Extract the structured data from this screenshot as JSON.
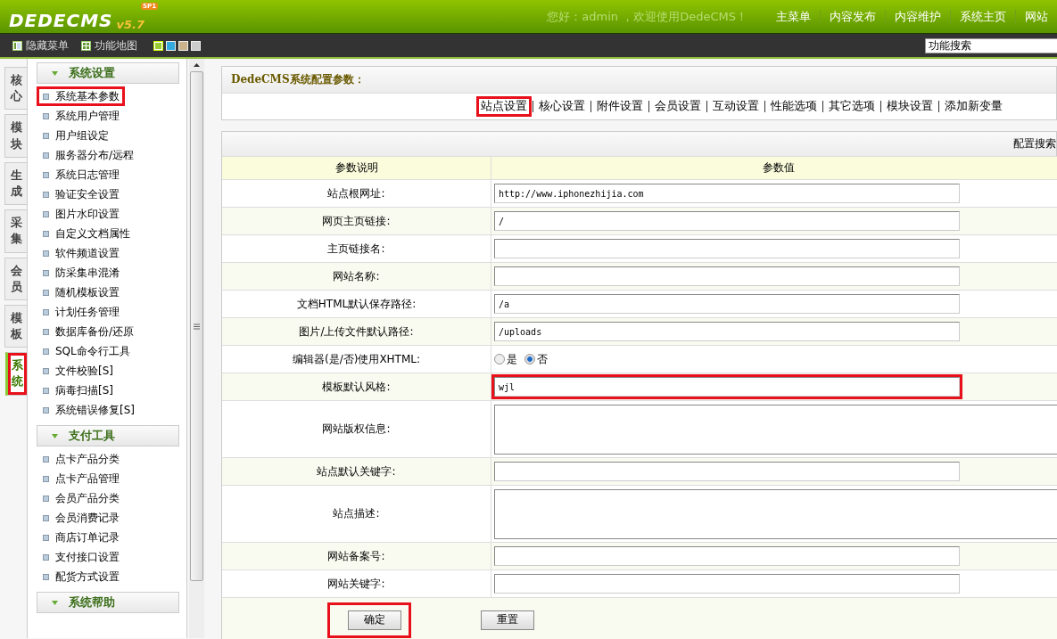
{
  "header": {
    "logo": "DEDECMS",
    "version": "v5.7",
    "badge": "SP1",
    "greeting": "您好：admin ，欢迎使用DedeCMS！",
    "nav": [
      "主菜单",
      "内容发布",
      "内容维护",
      "系统主页",
      "网站"
    ]
  },
  "toolbar": {
    "buttons": [
      {
        "kind": "hide",
        "label": "隐藏菜单"
      },
      {
        "kind": "map",
        "label": "功能地图"
      }
    ],
    "swatches": [
      {
        "color": "#99cc33",
        "selected": true
      },
      {
        "color": "#33aadd",
        "selected": false
      },
      {
        "color": "#ccb38c",
        "selected": false
      },
      {
        "color": "#cccccc",
        "selected": false
      }
    ],
    "search": {
      "value": "功能搜索"
    }
  },
  "side_tabs": [
    {
      "label": "核心",
      "selected": false,
      "highlighted": false
    },
    {
      "label": "模块",
      "selected": false,
      "highlighted": false
    },
    {
      "label": "生成",
      "selected": false,
      "highlighted": false
    },
    {
      "label": "采集",
      "selected": false,
      "highlighted": false
    },
    {
      "label": "会员",
      "selected": false,
      "highlighted": false
    },
    {
      "label": "模板",
      "selected": false,
      "highlighted": false
    },
    {
      "label": "系统",
      "selected": true,
      "highlighted": true
    }
  ],
  "sidebar": {
    "groups": [
      {
        "title": "系统设置",
        "items": [
          {
            "label": "系统基本参数",
            "highlighted": true
          },
          {
            "label": "系统用户管理",
            "highlighted": false
          },
          {
            "label": "用户组设定",
            "highlighted": false
          },
          {
            "label": "服务器分布/远程",
            "highlighted": false
          },
          {
            "label": "系统日志管理",
            "highlighted": false
          },
          {
            "label": "验证安全设置",
            "highlighted": false
          },
          {
            "label": "图片水印设置",
            "highlighted": false
          },
          {
            "label": "自定义文档属性",
            "highlighted": false
          },
          {
            "label": "软件频道设置",
            "highlighted": false
          },
          {
            "label": "防采集串混淆",
            "highlighted": false
          },
          {
            "label": "随机模板设置",
            "highlighted": false
          },
          {
            "label": "计划任务管理",
            "highlighted": false
          },
          {
            "label": "数据库备份/还原",
            "highlighted": false
          },
          {
            "label": "SQL命令行工具",
            "highlighted": false
          },
          {
            "label": "文件校验[S]",
            "highlighted": false
          },
          {
            "label": "病毒扫描[S]",
            "highlighted": false
          },
          {
            "label": "系统错误修复[S]",
            "highlighted": false
          }
        ]
      },
      {
        "title": "支付工具",
        "items": [
          {
            "label": "点卡产品分类",
            "highlighted": false
          },
          {
            "label": "点卡产品管理",
            "highlighted": false
          },
          {
            "label": "会员产品分类",
            "highlighted": false
          },
          {
            "label": "会员消费记录",
            "highlighted": false
          },
          {
            "label": "商店订单记录",
            "highlighted": false
          },
          {
            "label": "支付接口设置",
            "highlighted": false
          },
          {
            "label": "配货方式设置",
            "highlighted": false
          }
        ]
      },
      {
        "title": "系统帮助"
      }
    ]
  },
  "panel": {
    "title": "DedeCMS系统配置参数：",
    "tabs": [
      {
        "label": "站点设置",
        "highlighted": true
      },
      {
        "label": "核心设置",
        "highlighted": false
      },
      {
        "label": "附件设置",
        "highlighted": false
      },
      {
        "label": "会员设置",
        "highlighted": false
      },
      {
        "label": "互动设置",
        "highlighted": false
      },
      {
        "label": "性能选项",
        "highlighted": false
      },
      {
        "label": "其它选项",
        "highlighted": false
      },
      {
        "label": "模块设置",
        "highlighted": false
      },
      {
        "label": "添加新变量",
        "highlighted": false
      }
    ]
  },
  "table": {
    "search_label": "配置搜索",
    "columns": [
      "参数说明",
      "参数值"
    ],
    "rows": [
      {
        "label": "站点根网址:",
        "kind": "text",
        "value": "http://www.iphonezhijia.com",
        "highlighted": false
      },
      {
        "label": "网页主页链接:",
        "kind": "text",
        "value": "/",
        "highlighted": false
      },
      {
        "label": "主页链接名:",
        "kind": "text",
        "value": "",
        "highlighted": false
      },
      {
        "label": "网站名称:",
        "kind": "text",
        "value": "",
        "highlighted": false
      },
      {
        "label": "文档HTML默认保存路径:",
        "kind": "text",
        "value": "/a",
        "highlighted": false
      },
      {
        "label": "图片/上传文件默认路径:",
        "kind": "text",
        "value": "/uploads",
        "highlighted": false
      },
      {
        "label": "编辑器(是/否)使用XHTML:",
        "kind": "radio",
        "options": [
          {
            "label": "是",
            "selected": false
          },
          {
            "label": "否",
            "selected": true
          }
        ],
        "highlighted": false
      },
      {
        "label": "模板默认风格:",
        "kind": "text",
        "value": "wjl",
        "highlighted": true
      },
      {
        "label": "网站版权信息:",
        "kind": "textarea",
        "value": "",
        "highlighted": false
      },
      {
        "label": "站点默认关键字:",
        "kind": "text",
        "value": "",
        "highlighted": false
      },
      {
        "label": "站点描述:",
        "kind": "textarea",
        "value": "",
        "highlighted": false
      },
      {
        "label": "网站备案号:",
        "kind": "text",
        "value": "",
        "highlighted": false
      },
      {
        "label": "网站关键字:",
        "kind": "text",
        "value": "",
        "highlighted": false
      }
    ],
    "buttons": [
      {
        "label": "确定",
        "highlighted": true
      },
      {
        "label": "重置",
        "highlighted": false
      }
    ]
  }
}
